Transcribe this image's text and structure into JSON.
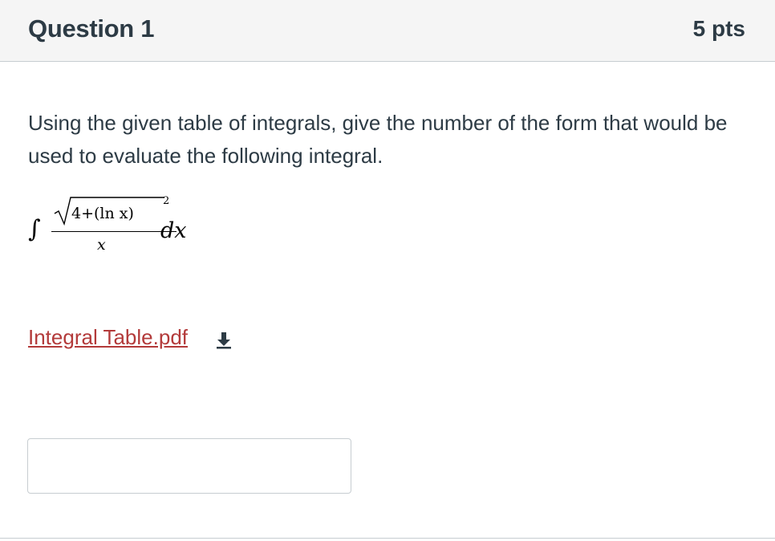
{
  "header": {
    "title": "Question 1",
    "points": "5 pts"
  },
  "question": {
    "text": "Using the given table of integrals, give the number of the form that would be used to evaluate the following integral.",
    "integral": {
      "sign": "∫",
      "radicand": "4+(ln x)",
      "exponent": "2",
      "denominator": "x",
      "differential": "dx"
    }
  },
  "attachment": {
    "label": "Integral Table.pdf",
    "icon": "download-icon"
  },
  "answer": {
    "value": "",
    "placeholder": ""
  }
}
